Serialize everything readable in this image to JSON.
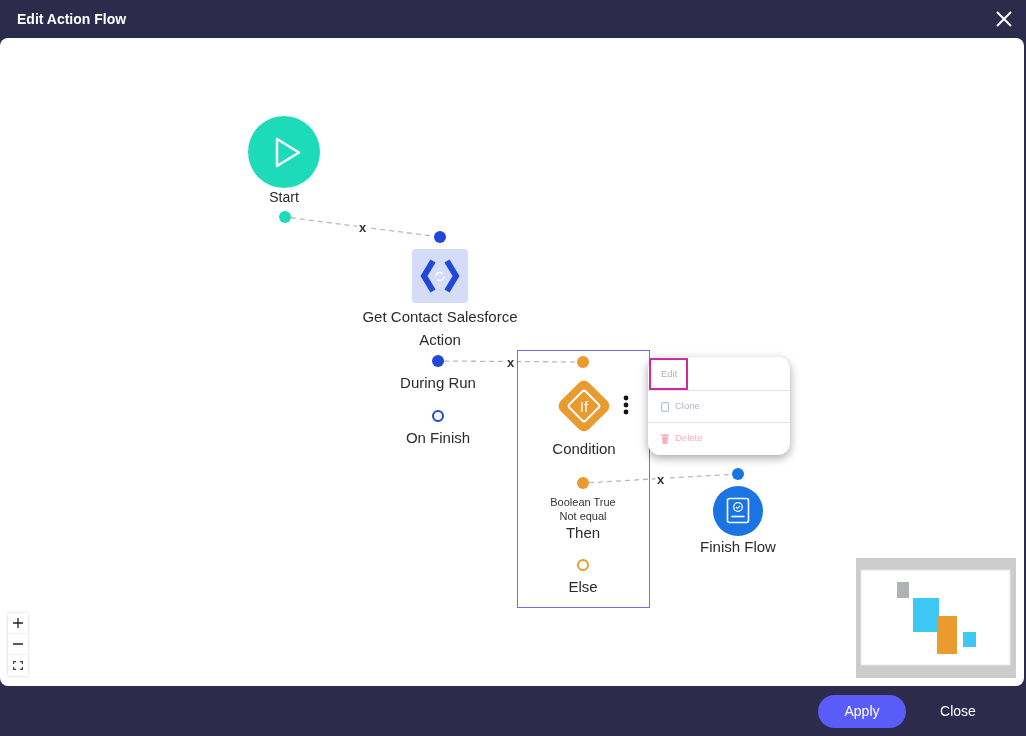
{
  "window": {
    "title": "Edit Action Flow"
  },
  "canvas": {
    "nodes": [
      {
        "kind": "start",
        "label": "Start",
        "color": "#1ddbb8",
        "selected": false,
        "outputs": [
          {
            "connected": true
          }
        ]
      },
      {
        "kind": "action",
        "label": "Get Contact Salesforce Action",
        "color": "#2148d8",
        "selected": false,
        "input": {
          "connected": true
        },
        "outputs": [
          {
            "label": "During Run",
            "connected": true
          },
          {
            "label": "On Finish",
            "connected": false
          }
        ]
      },
      {
        "kind": "condition",
        "label": "Condition",
        "icon_text": "If",
        "color": "#e99b2f",
        "selected": true,
        "input": {
          "connected": true
        },
        "outputs": [
          {
            "details": [
              "Boolean True",
              "Not equal"
            ],
            "label": "Then",
            "connected": true
          },
          {
            "label": "Else",
            "connected": false
          }
        ],
        "menu": {
          "items": [
            {
              "kind": "edit",
              "label": "Edit",
              "selected": true
            },
            {
              "kind": "clone",
              "label": "Clone",
              "selected": false
            },
            {
              "kind": "delete",
              "label": "Delete",
              "selected": false
            }
          ]
        }
      },
      {
        "kind": "finish",
        "label": "Finish Flow",
        "color": "#1b74e4",
        "selected": false,
        "input": {
          "connected": true
        }
      }
    ],
    "edges": [
      {
        "label": "x"
      },
      {
        "label": "x"
      },
      {
        "label": "x"
      }
    ]
  },
  "footer": {
    "buttons": [
      {
        "kind": "primary",
        "label": "Apply"
      },
      {
        "kind": "secondary",
        "label": "Close"
      }
    ]
  }
}
